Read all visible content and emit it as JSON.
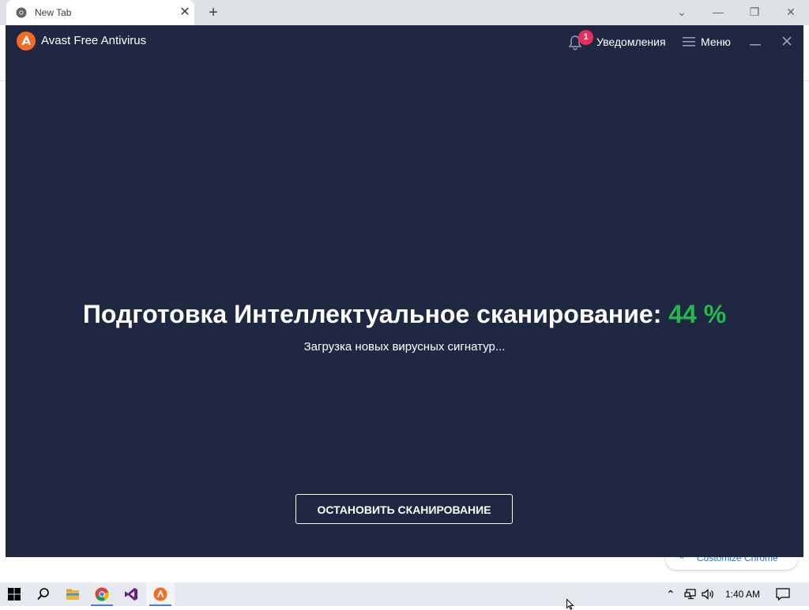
{
  "browser": {
    "tab_title": "New Tab",
    "tab_close": "✕",
    "new_tab": "+",
    "controls": {
      "dropdown": "⌄",
      "minimize": "—",
      "restore": "❐",
      "close": "✕"
    }
  },
  "chrome_page": {
    "customize_label": "Customize Chrome"
  },
  "avast": {
    "app_title": "Avast Free Antivirus",
    "notifications": {
      "count": "1",
      "label": "Уведомления"
    },
    "menu_label": "Меню",
    "scan": {
      "headline": "Подготовка Интеллектуальное сканирование:",
      "percent": "44 %",
      "progress": 0.44,
      "status": "Загрузка новых вирусных сигнатур..."
    },
    "stop_button": "ОСТАНОВИТЬ СКАНИРОВАНИЕ"
  },
  "taskbar": {
    "apps": [
      "start-icon",
      "search-icon",
      "file-explorer-icon",
      "chrome-icon",
      "visual-studio-icon",
      "avast-icon"
    ],
    "clock": "1:40 AM"
  },
  "colors": {
    "avast_bg": "#202742",
    "accent_green": "#1fbb4b",
    "badge_red": "#e5305e",
    "avast_orange": "#f26c22"
  }
}
